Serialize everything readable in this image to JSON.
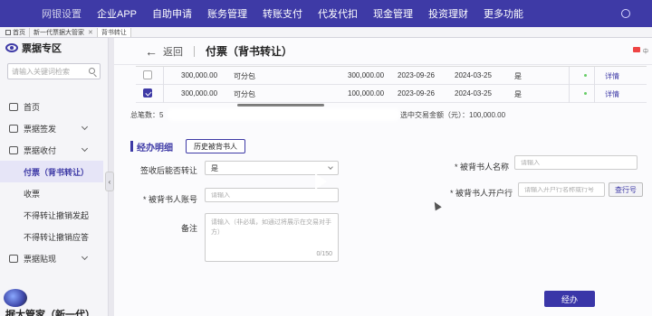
{
  "topnav": {
    "items": [
      "网银设置",
      "企业APP",
      "自助申请",
      "账务管理",
      "转账支付",
      "代发代扣",
      "现金管理",
      "投资理财",
      "更多功能"
    ]
  },
  "tabs": [
    {
      "label": "首页"
    },
    {
      "label": "新一代票据大管家"
    },
    {
      "label": "背书转让"
    }
  ],
  "sidebar": {
    "title": "票据专区",
    "search_placeholder": "请输入关键词检索",
    "items": [
      {
        "label": "首页"
      },
      {
        "label": "票据签发"
      },
      {
        "label": "票据收付"
      },
      {
        "label": "付票（背书转让）"
      },
      {
        "label": "收票"
      },
      {
        "label": "不得转让撤销发起"
      },
      {
        "label": "不得转让撤销应答"
      },
      {
        "label": "票据贴现"
      }
    ],
    "logo_text": "据大管家（新一代）"
  },
  "header": {
    "back_label": "返回",
    "title": "付票（背书转让）",
    "tools": "中"
  },
  "table": {
    "rows": [
      {
        "checked": false,
        "amount": "300,000.00",
        "split": "可分包",
        "sub_amount": "300,000.00",
        "start_date": "2023-09-26",
        "end_date": "2024-03-25",
        "flag": "是",
        "action": "详情"
      },
      {
        "checked": true,
        "amount": "300,000.00",
        "split": "可分包",
        "sub_amount": "100,000.00",
        "start_date": "2023-09-26",
        "end_date": "2024-03-25",
        "flag": "是",
        "action": "详情"
      }
    ]
  },
  "summary": {
    "total_label": "总笔数：",
    "total_value": "5",
    "selected_label": "选中交易金额（元）：",
    "selected_value": "100,000.00"
  },
  "section": {
    "title": "经办明细",
    "history_button": "历史被背书人"
  },
  "form": {
    "transfer_label": "签收后能否转让",
    "transfer_value": "是",
    "payee_name_label": "* 被背书人名称",
    "payee_name_placeholder": "请输入",
    "payee_account_label": "* 被背书人账号",
    "payee_account_placeholder": "请输入",
    "payee_bank_label": "* 被背书人开户行",
    "payee_bank_placeholder": "请输入开户行名称或行号",
    "lookup_button": "查行号",
    "remark_label": "备注",
    "remark_placeholder": "请输入（非必填，如通过将展示在交易对手方）",
    "remark_counter": "0/150",
    "submit_button": "经办"
  }
}
